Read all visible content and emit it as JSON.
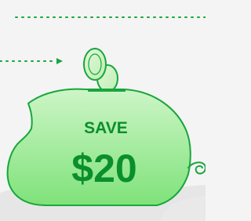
{
  "promo": {
    "heading": "SAVE",
    "amount": "$20"
  },
  "colors": {
    "background": "#f4f4f4",
    "accent": "#0a8f2c",
    "piggy_fill_top": "#c9f4c3",
    "piggy_fill_bottom": "#7ee37a",
    "coin_fill": "#d7f5cf",
    "floor": "#e6e6e6"
  },
  "icons": [
    "piggy-bank-icon",
    "coin-icon",
    "arrow-right-icon"
  ]
}
